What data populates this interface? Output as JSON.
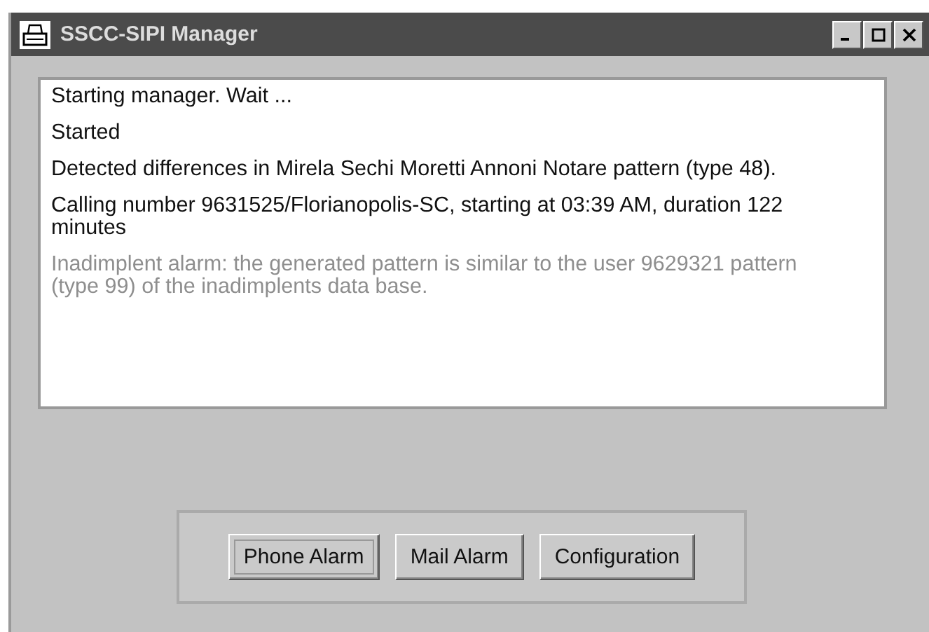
{
  "window": {
    "title": "SSCC-SIPI Manager"
  },
  "messages": [
    {
      "text": "Starting manager. Wait ...",
      "kind": "normal"
    },
    {
      "text": "Started",
      "kind": "normal"
    },
    {
      "text": "Detected differences in Mirela Sechi Moretti Annoni Notare pattern (type 48).",
      "kind": "normal"
    },
    {
      "text": "Calling number 9631525/Florianopolis-SC, starting at 03:39 AM, duration 122 minutes",
      "kind": "normal"
    },
    {
      "text": "Inadimplent alarm: the generated pattern is similar to the user 9629321 pattern (type 99) of the inadimplents data base.",
      "kind": "alarm"
    }
  ],
  "buttons": [
    {
      "label": "Phone Alarm",
      "focused": true
    },
    {
      "label": "Mail Alarm",
      "focused": false
    },
    {
      "label": "Configuration",
      "focused": false
    }
  ]
}
